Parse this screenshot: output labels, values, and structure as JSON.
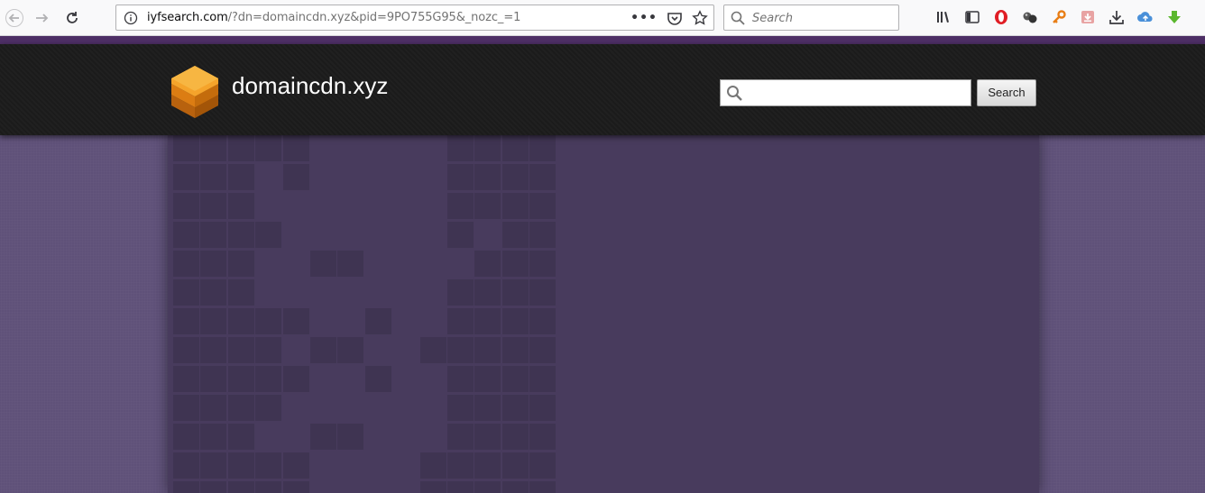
{
  "browser": {
    "url_host": "iyfsearch.com",
    "url_rest": "/?dn=domaincdn.xyz&pid=9PO755G95&_nozc_=1",
    "search_placeholder": "Search",
    "page_actions_label": "•••"
  },
  "site": {
    "title": "domaincdn.xyz",
    "search_button_label": "Search",
    "search_value": ""
  },
  "colors": {
    "accent": "#4e2f66",
    "header_bg": "#1b1b1b",
    "page_bg": "#5f5179",
    "panel_bg": "#483b5d",
    "logo_orange": "#f09a1e"
  }
}
